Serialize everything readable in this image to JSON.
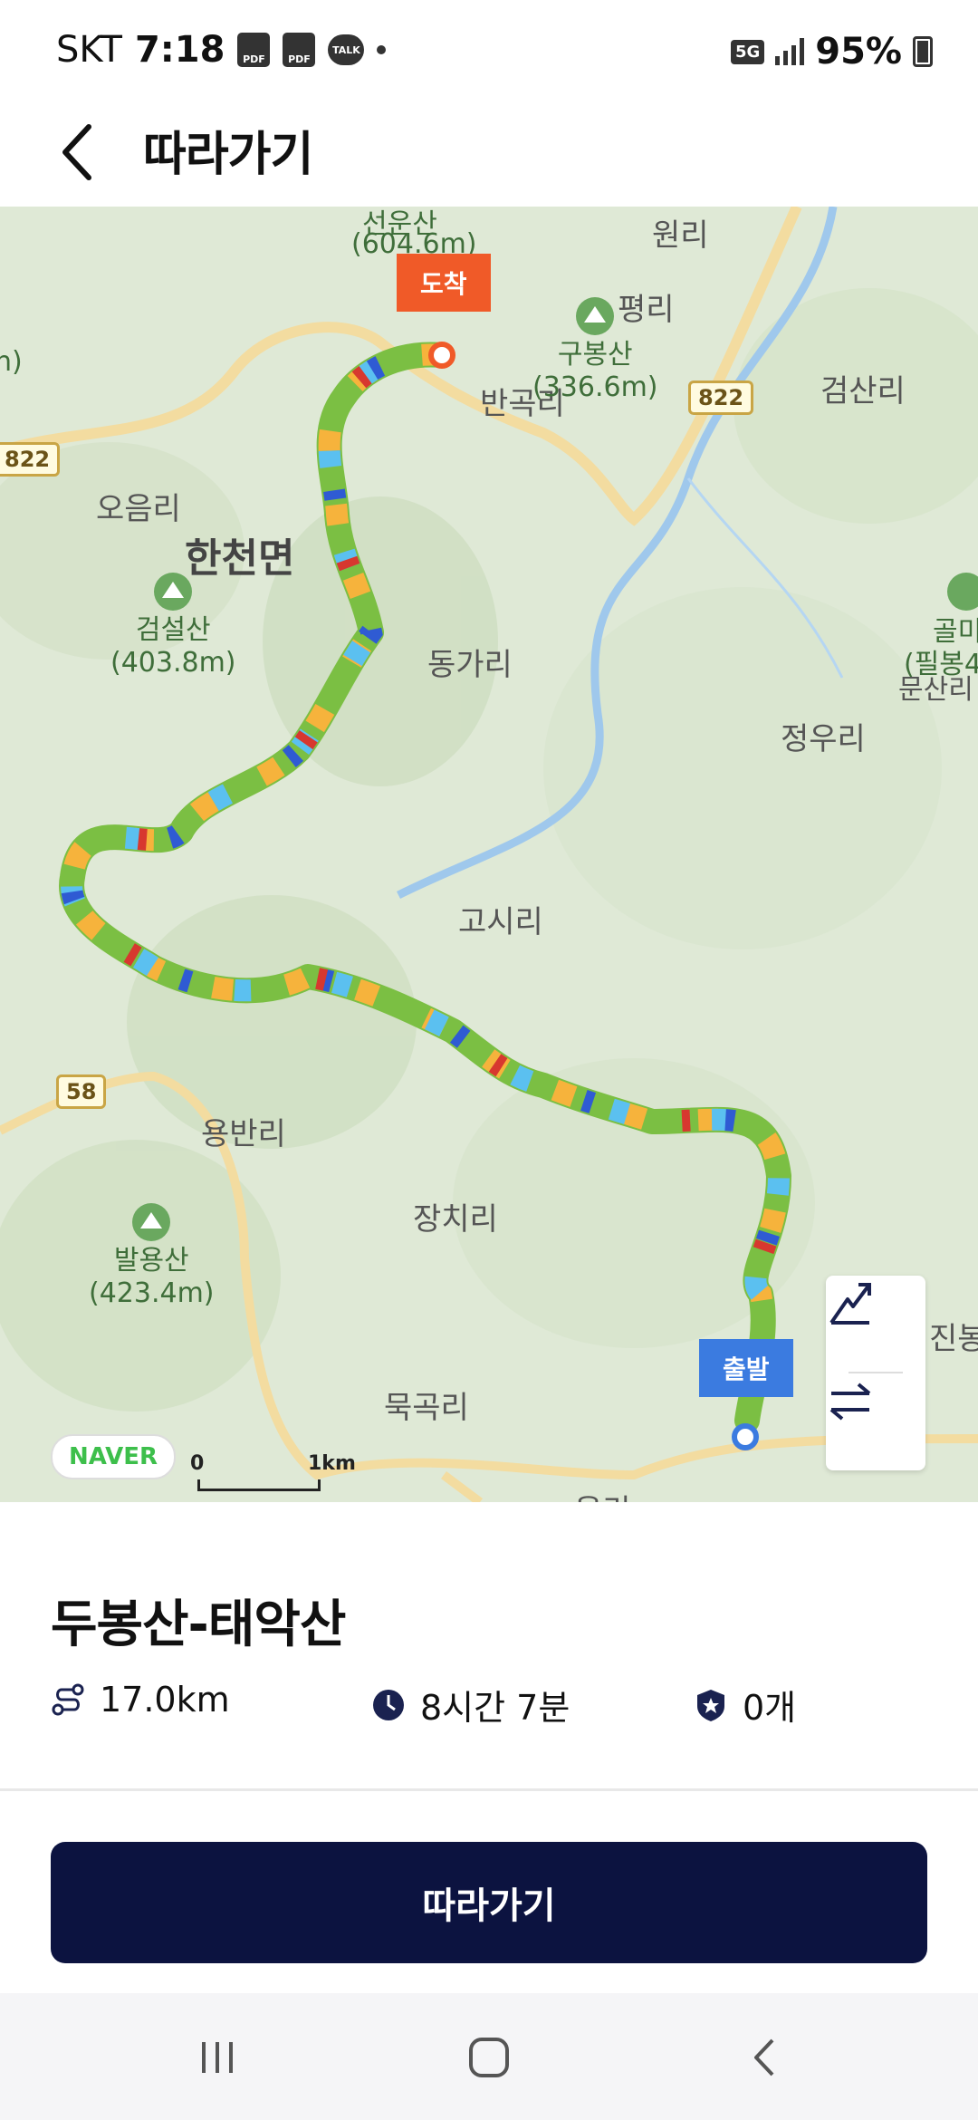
{
  "status_bar": {
    "carrier": "SKT",
    "time": "7:18",
    "notif_icons": [
      "PDF",
      "PDF",
      "TALK"
    ],
    "network": "5G",
    "battery": "95%"
  },
  "header": {
    "back_icon": "chevron-left-icon",
    "title": "따라가기"
  },
  "map": {
    "places": {
      "seonunsan": "선운산",
      "wonri": "원리",
      "pyeongri": "평리",
      "bangokri": "반곡리",
      "geomsanri": "검산리",
      "oeumri": "오음리",
      "hancheon": "한천면",
      "donggari": "동가리",
      "jeongwuri": "정우리",
      "gosiri": "고시리",
      "yongbanri": "용반리",
      "jangchiri": "장치리",
      "mukgokri": "묵곡리",
      "jinbong": "진봉",
      "gol": "골미",
      "pilbong": "(필봉4",
      "munsan": "문산리",
      "yongri": "용리"
    },
    "mountains": {
      "seonunsan_height": "(604.6m)",
      "gubongsan": "구봉산",
      "gubongsan_height": "(336.6m)",
      "geomseolsan": "검설산",
      "geomseolsan_height": "(403.8m)",
      "balyongsan": "발용산",
      "balyongsan_height": "(423.4m)",
      "edge_left": "n)"
    },
    "roads": [
      "822",
      "822",
      "58"
    ],
    "arrive_label": "도착",
    "depart_label": "출발",
    "naver_logo": "NAVER",
    "scale_zero": "0",
    "scale_km": "1km",
    "controls": [
      "elevation-profile-icon",
      "swap-direction-icon"
    ]
  },
  "route": {
    "name": "두봉산-태악산",
    "distance": "17.0km",
    "duration": "8시간 7분",
    "badges": "0개",
    "distance_icon": "route-icon",
    "duration_icon": "clock-icon",
    "badge_icon": "star-badge-icon"
  },
  "follow_button": "따라가기",
  "nav_bar": [
    "recent-apps-icon",
    "home-icon",
    "back-icon"
  ],
  "colors": {
    "accent_dark": "#0c1340",
    "arrive": "#f05a28",
    "depart": "#3b7be0",
    "route_green": "#8cc63f",
    "route_orange": "#f6b33c",
    "route_red": "#d7382f",
    "route_blue": "#2f5bd3",
    "route_sky": "#5bc0f0"
  }
}
